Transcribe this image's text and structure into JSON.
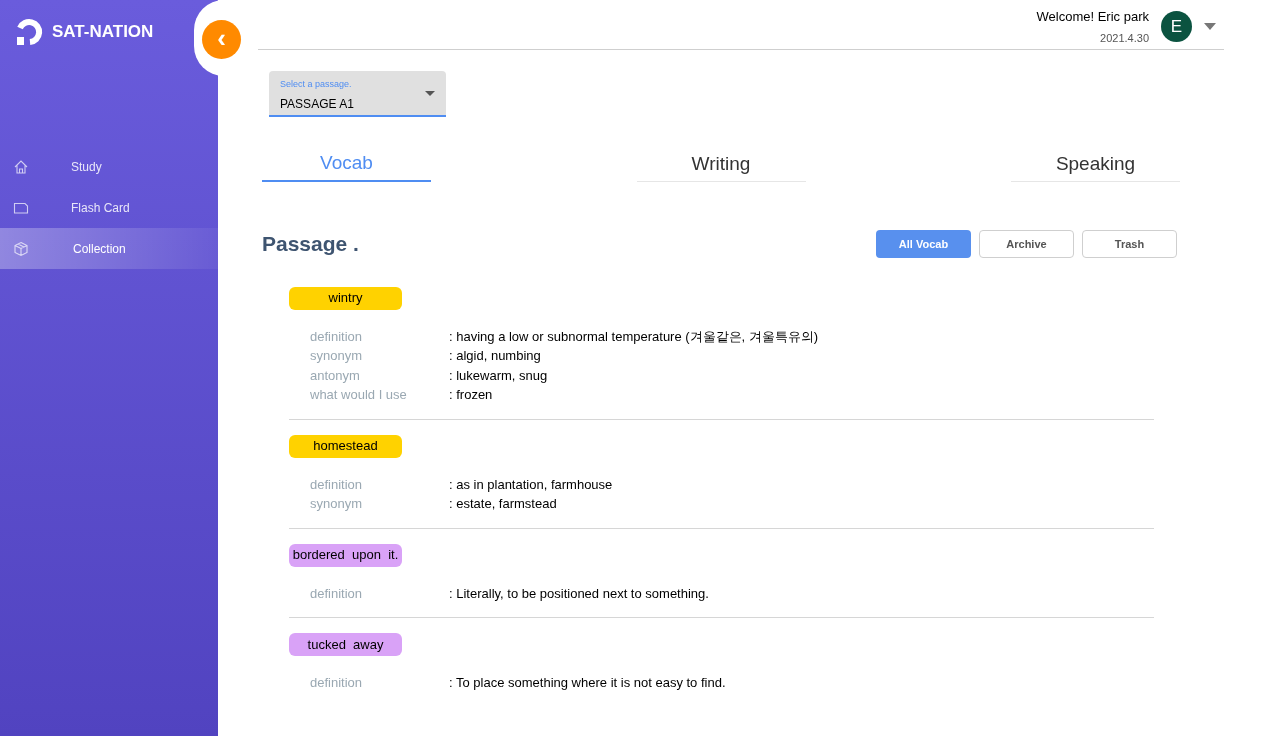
{
  "sidebar": {
    "logo": "SAT-NATION",
    "collapse_button": "‹",
    "items": [
      {
        "label": "Study",
        "selected": false
      },
      {
        "label": "Flash Card",
        "selected": false
      },
      {
        "label": "Collection",
        "selected": true
      }
    ]
  },
  "header": {
    "welcome": "Welcome! Eric park",
    "date": "2021.4.30",
    "avatar": "E"
  },
  "passage_select": {
    "label": "Select a passage.",
    "value": "PASSAGE A1"
  },
  "tabs": [
    {
      "label": "Vocab",
      "selected": true
    },
    {
      "label": "Writing",
      "selected": false
    },
    {
      "label": "Speaking",
      "selected": false
    }
  ],
  "section_title": "Passage .",
  "filters": [
    {
      "label": "All Vocab",
      "selected": true
    },
    {
      "label": "Archive",
      "selected": false
    },
    {
      "label": "Trash",
      "selected": false
    }
  ],
  "words": [
    {
      "word": "wintry",
      "color": "#ffd200",
      "fields": [
        {
          "label": "definition",
          "value": ": having a low or subnormal temperature (겨울같은, 겨울특유의)"
        },
        {
          "label": "synonym",
          "value": ": algid, numbing"
        },
        {
          "label": "antonym",
          "value": ": lukewarm, snug"
        },
        {
          "label": "what would I use",
          "value": ": frozen"
        }
      ]
    },
    {
      "word": "homestead",
      "color": "#ffd200",
      "fields": [
        {
          "label": "definition",
          "value": ": as in plantation, farmhouse"
        },
        {
          "label": "synonym",
          "value": ": estate, farmstead"
        }
      ]
    },
    {
      "word": "bordered  upon  it.",
      "color": "#d9a2f7",
      "fields": [
        {
          "label": "definition",
          "value": ": Literally, to be positioned next to something."
        }
      ]
    },
    {
      "word": "tucked  away",
      "color": "#d9a2f7",
      "fields": [
        {
          "label": "definition",
          "value": ": To place something where it is not easy to find."
        }
      ]
    }
  ]
}
